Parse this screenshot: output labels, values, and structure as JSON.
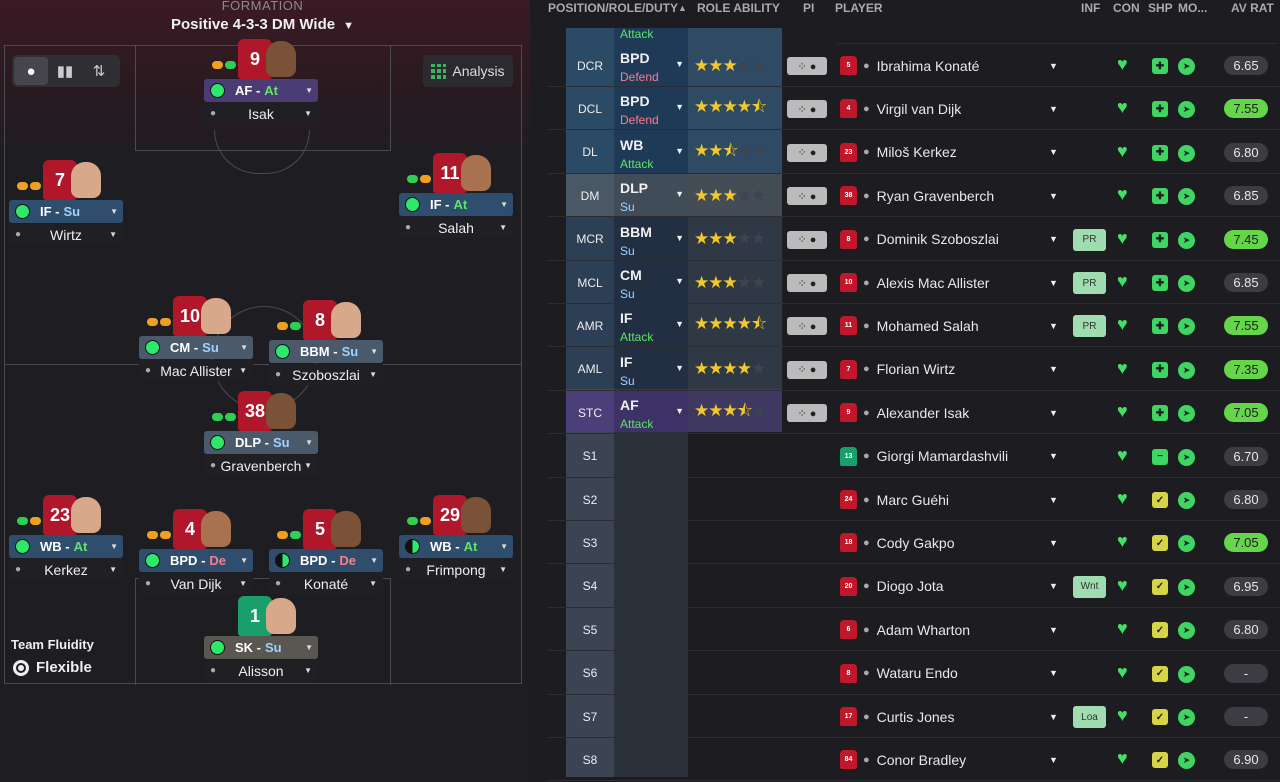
{
  "formation": {
    "label": "FORMATION",
    "name": "Positive 4-3-3 DM Wide"
  },
  "view_toggle": {
    "icons": [
      "person-icon",
      "bar-chart-icon",
      "exchange-icon"
    ]
  },
  "analysis_label": "Analysis",
  "fluidity": {
    "label": "Team Fluidity",
    "value": "Flexible"
  },
  "pitch_players": [
    {
      "number": "9",
      "role": "AF",
      "duty": "At",
      "name": "Isak"
    },
    {
      "number": "7",
      "role": "IF",
      "duty": "Su",
      "name": "Wirtz"
    },
    {
      "number": "11",
      "role": "IF",
      "duty": "At",
      "name": "Salah"
    },
    {
      "number": "10",
      "role": "CM",
      "duty": "Su",
      "name": "Mac Allister"
    },
    {
      "number": "8",
      "role": "BBM",
      "duty": "Su",
      "name": "Szoboszlai"
    },
    {
      "number": "38",
      "role": "DLP",
      "duty": "Su",
      "name": "Gravenberch"
    },
    {
      "number": "23",
      "role": "WB",
      "duty": "At",
      "name": "Kerkez"
    },
    {
      "number": "4",
      "role": "BPD",
      "duty": "De",
      "name": "Van Dijk"
    },
    {
      "number": "5",
      "role": "BPD",
      "duty": "De",
      "name": "Konaté"
    },
    {
      "number": "29",
      "role": "WB",
      "duty": "At",
      "name": "Frimpong"
    },
    {
      "number": "1",
      "role": "SK",
      "duty": "Su",
      "name": "Alisson"
    }
  ],
  "table": {
    "headers": {
      "position": "POSITION/ROLE/DUTY",
      "role_ability": "ROLE ABILITY",
      "pi": "PI",
      "player": "PLAYER",
      "inf": "INF",
      "con": "CON",
      "shp": "SHP",
      "mo": "MO...",
      "av_rat": "AV RAT"
    },
    "partial_duty": "Attack",
    "rows": [
      {
        "pos": "DCR",
        "role": "BPD",
        "duty": "Defend",
        "stars": "★★★",
        "empty": "★★",
        "kit": "5",
        "player": "Ibrahima Konaté",
        "inf": "",
        "shp": "✚",
        "avr": "6.65"
      },
      {
        "pos": "DCL",
        "role": "BPD",
        "duty": "Defend",
        "stars": "★★★★⯪",
        "empty": "",
        "kit": "4",
        "player": "Virgil van Dijk",
        "inf": "",
        "shp": "✚",
        "avr": "7.55"
      },
      {
        "pos": "DL",
        "role": "WB",
        "duty": "Attack",
        "stars": "★★⯪",
        "empty": "★★",
        "kit": "23",
        "player": "Miloš Kerkez",
        "inf": "",
        "shp": "✚",
        "avr": "6.80"
      },
      {
        "pos": "DM",
        "role": "DLP",
        "duty": "Su",
        "stars": "★★★",
        "empty": "★★",
        "kit": "38",
        "player": "Ryan Gravenberch",
        "inf": "",
        "shp": "✚",
        "avr": "6.85"
      },
      {
        "pos": "MCR",
        "role": "BBM",
        "duty": "Su",
        "stars": "★★★",
        "empty": "★★",
        "kit": "8",
        "player": "Dominik Szoboszlai",
        "inf": "PR",
        "shp": "✚",
        "avr": "7.45"
      },
      {
        "pos": "MCL",
        "role": "CM",
        "duty": "Su",
        "stars": "★★★",
        "empty": "★★",
        "kit": "10",
        "player": "Alexis Mac Allister",
        "inf": "PR",
        "shp": "✚",
        "avr": "6.85"
      },
      {
        "pos": "AMR",
        "role": "IF",
        "duty": "Attack",
        "stars": "★★★★⯪",
        "empty": "",
        "kit": "11",
        "player": "Mohamed Salah",
        "inf": "PR",
        "shp": "✚",
        "avr": "7.55"
      },
      {
        "pos": "AML",
        "role": "IF",
        "duty": "Su",
        "stars": "★★★★",
        "empty": "★",
        "kit": "7",
        "player": "Florian Wirtz",
        "inf": "",
        "shp": "✚",
        "avr": "7.35"
      },
      {
        "pos": "STC",
        "role": "AF",
        "duty": "Attack",
        "stars": "★★★⯪",
        "empty": "★",
        "kit": "9",
        "player": "Alexander Isak",
        "inf": "",
        "shp": "✚",
        "avr": "7.05"
      },
      {
        "pos": "S1",
        "role": "",
        "duty": "",
        "stars": "",
        "empty": "",
        "kit": "13",
        "player": "Giorgi Mamardashvili",
        "inf": "",
        "shp": "−",
        "avr": "6.70"
      },
      {
        "pos": "S2",
        "role": "",
        "duty": "",
        "stars": "",
        "empty": "",
        "kit": "24",
        "player": "Marc Guéhi",
        "inf": "",
        "shp": "✓",
        "avr": "6.80"
      },
      {
        "pos": "S3",
        "role": "",
        "duty": "",
        "stars": "",
        "empty": "",
        "kit": "18",
        "player": "Cody Gakpo",
        "inf": "",
        "shp": "✓",
        "avr": "7.05"
      },
      {
        "pos": "S4",
        "role": "",
        "duty": "",
        "stars": "",
        "empty": "",
        "kit": "20",
        "player": "Diogo Jota",
        "inf": "Wnt",
        "shp": "✓",
        "avr": "6.95"
      },
      {
        "pos": "S5",
        "role": "",
        "duty": "",
        "stars": "",
        "empty": "",
        "kit": "6",
        "player": "Adam Wharton",
        "inf": "",
        "shp": "✓",
        "avr": "6.80"
      },
      {
        "pos": "S6",
        "role": "",
        "duty": "",
        "stars": "",
        "empty": "",
        "kit": "8",
        "player": "Wataru Endo",
        "inf": "",
        "shp": "✓",
        "avr": "-"
      },
      {
        "pos": "S7",
        "role": "",
        "duty": "",
        "stars": "",
        "empty": "",
        "kit": "17",
        "player": "Curtis Jones",
        "inf": "Loa",
        "shp": "✓",
        "avr": "-"
      },
      {
        "pos": "S8",
        "role": "",
        "duty": "",
        "stars": "",
        "empty": "",
        "kit": "84",
        "player": "Conor Bradley",
        "inf": "",
        "shp": "✓",
        "avr": "6.90"
      }
    ]
  },
  "colors": {
    "attack": "#5ee466",
    "defend": "#ff7a8a",
    "support": "#9fd2ff",
    "good_rating": "#65d54a"
  }
}
